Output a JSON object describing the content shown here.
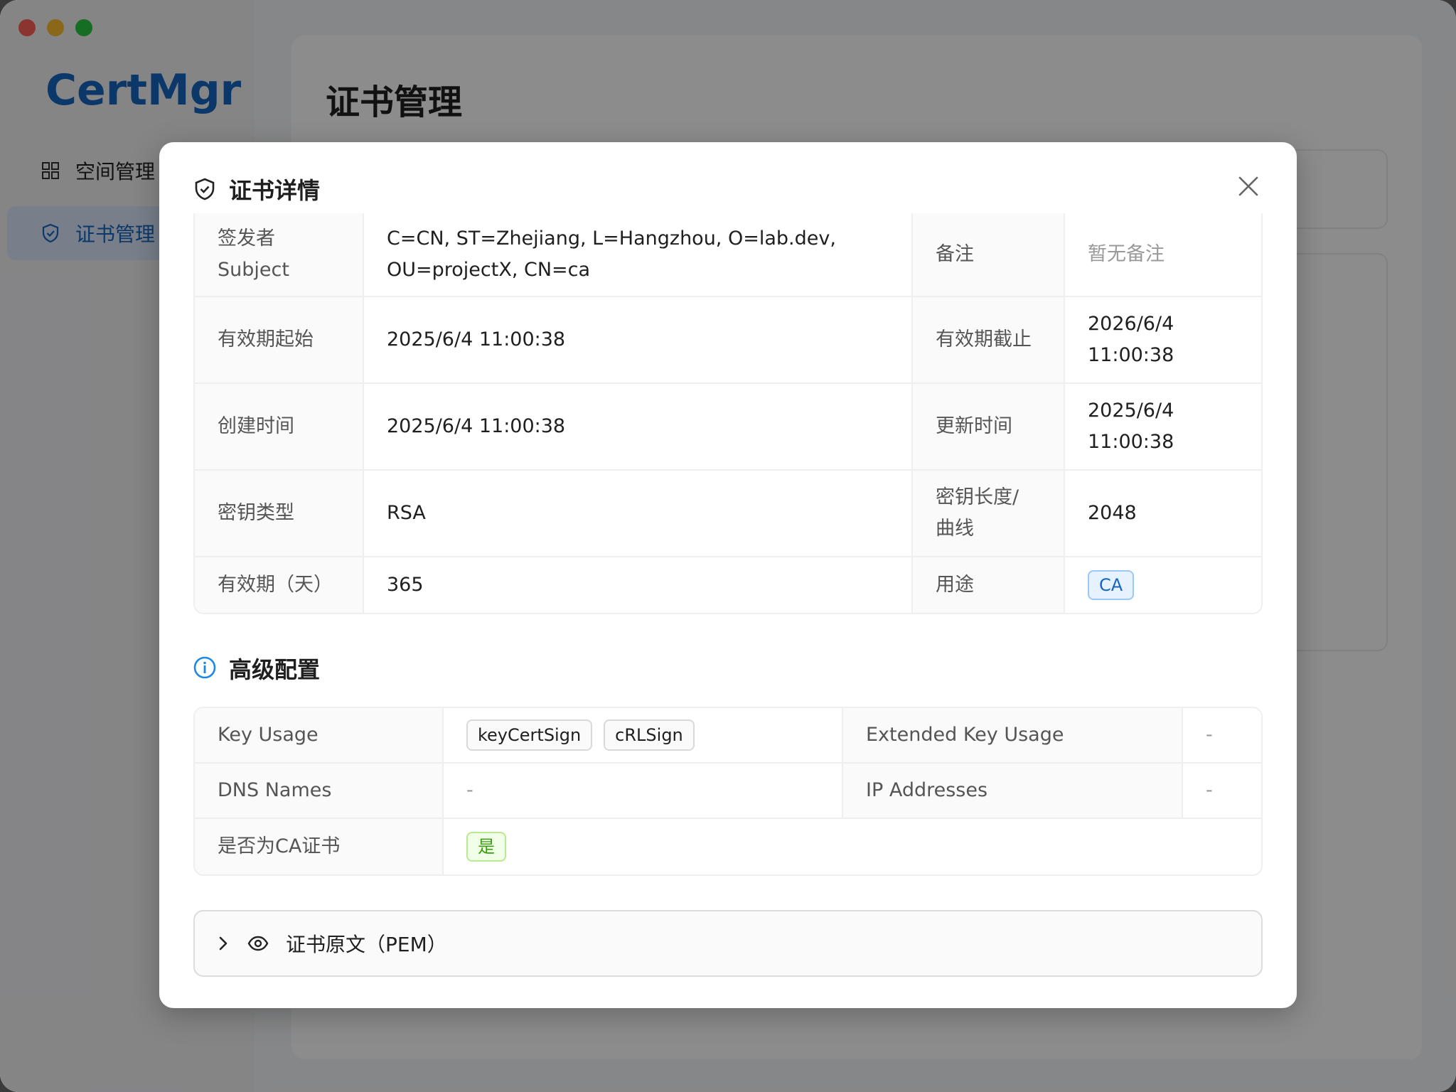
{
  "app": {
    "logo": "CertMgr"
  },
  "sidebar": {
    "items": [
      {
        "label": "空间管理",
        "icon": "grid-icon"
      },
      {
        "label": "证书管理",
        "icon": "shield-icon",
        "active": true
      }
    ]
  },
  "main": {
    "title": "证书管理"
  },
  "modal": {
    "title": "证书详情",
    "close_icon": "close-icon",
    "details": {
      "subject_label": "签发者\nSubject",
      "subject_value": "C=CN, ST=Zhejiang, L=Hangzhou, O=lab.dev,\nOU=projectX, CN=ca",
      "remark_label": "备注",
      "remark_value": "暂无备注",
      "valid_from_label": "有效期起始",
      "valid_from_value": "2025/6/4 11:00:38",
      "valid_to_label": "有效期截止",
      "valid_to_value": "2026/6/4\n11:00:38",
      "created_label": "创建时间",
      "created_value": "2025/6/4 11:00:38",
      "updated_label": "更新时间",
      "updated_value": "2025/6/4\n11:00:38",
      "key_type_label": "密钥类型",
      "key_type_value": "RSA",
      "key_len_label": "密钥长度/\n曲线",
      "key_len_value": "2048",
      "validity_days_label": "有效期（天）",
      "validity_days_value": "365",
      "usage_label": "用途",
      "usage_value": "CA"
    },
    "advanced": {
      "title": "高级配置",
      "key_usage_label": "Key Usage",
      "key_usage_values": [
        "keyCertSign",
        "cRLSign"
      ],
      "ext_key_usage_label": "Extended Key Usage",
      "ext_key_usage_value": "-",
      "dns_label": "DNS Names",
      "dns_value": "-",
      "ip_label": "IP Addresses",
      "ip_value": "-",
      "is_ca_label": "是否为CA证书",
      "is_ca_value": "是"
    },
    "pem": {
      "label": "证书原文（PEM）"
    }
  },
  "colors": {
    "accent": "#1565c0",
    "active_bg": "#dbe8fb",
    "green": "#389e0d"
  }
}
